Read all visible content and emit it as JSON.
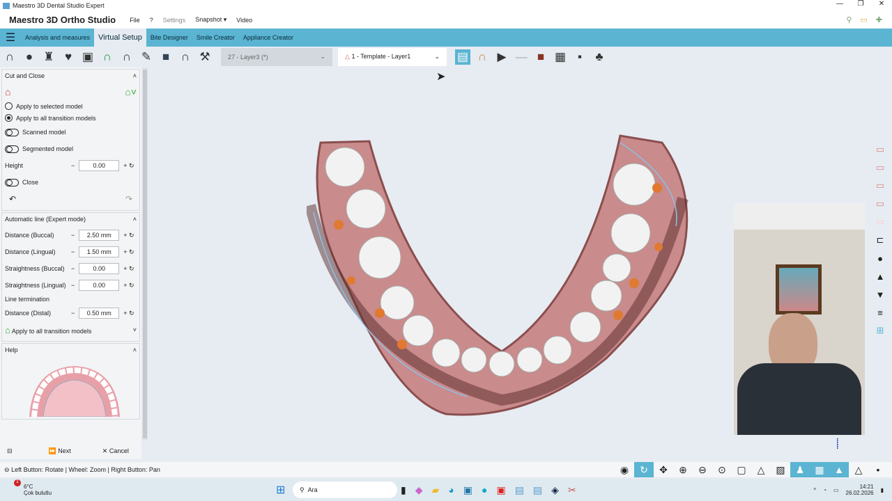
{
  "window": {
    "title": "Maestro 3D Dental Studio Expert",
    "controls": [
      "—",
      "❐",
      "✕"
    ]
  },
  "menu": {
    "app_name": "Maestro 3D Ortho Studio",
    "items": [
      "File",
      "?",
      "Settings",
      "Snapshot",
      "Video"
    ],
    "snapshot_arrow": "▾"
  },
  "tabs": {
    "items": [
      "Analysis and measures",
      "Virtual Setup",
      "Bite Designer",
      "Smile Creator",
      "Appliance Creator"
    ],
    "active": "Virtual Setup"
  },
  "toolbar": {
    "layer_select": "27 - Layer3 (*)",
    "template_select": "1 - Template - Layer1",
    "dropdown_arrow": "⌄"
  },
  "panel": {
    "cut_close": {
      "title": "Cut and Close",
      "radio_selected_model": "Apply to selected model",
      "radio_all_models": "Apply to all transition models",
      "scanned": "Scanned model",
      "segmented": "Segmented model",
      "height_label": "Height",
      "height_value": "0.00",
      "close": "Close"
    },
    "auto_line": {
      "title": "Automatic line (Expert mode)",
      "rows": [
        {
          "label": "Distance (Buccal)",
          "value": "2.50 mm"
        },
        {
          "label": "Distance (Lingual)",
          "value": "1.50 mm"
        },
        {
          "label": "Straightness (Buccal)",
          "value": "0.00"
        },
        {
          "label": "Straightness (Lingual)",
          "value": "0.00"
        }
      ],
      "termination": "Line termination",
      "distal_label": "Distance (Distal)",
      "distal_value": "0.50 mm",
      "apply_all": "Apply to all transition models"
    },
    "help": {
      "title": "Help"
    },
    "minus": "−",
    "plus": "+",
    "reset": "↻",
    "collapse": "˄"
  },
  "footer": {
    "next": "Next",
    "cancel": "Cancel"
  },
  "status": {
    "text": "Left Button: Rotate | Wheel: Zoom | Right Button: Pan"
  },
  "taskbar": {
    "weather_temp": "6°C",
    "weather_desc": "Çok bulutlu",
    "weather_badge": "1",
    "search": "Ara",
    "time": "14:21",
    "date": "26.02.2026"
  },
  "colors": {
    "accent": "#5ab4d2",
    "gum": "#c98b8b",
    "tooth": "#f0f0f0",
    "attachment": "#e07a30"
  }
}
